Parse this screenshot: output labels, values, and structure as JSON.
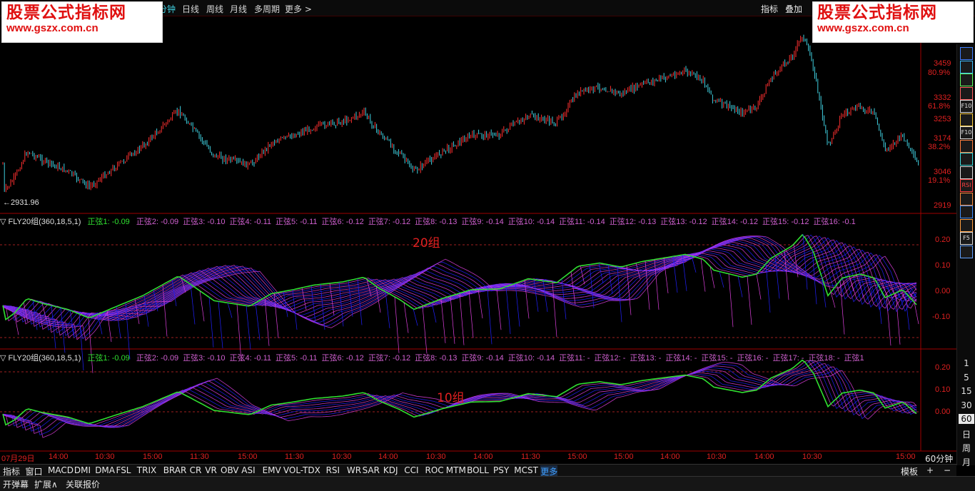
{
  "topbar": {
    "items": [
      "分钟",
      "日线",
      "周线",
      "月线",
      "多周期",
      "更多 >"
    ],
    "right_items": [
      "指标",
      "叠加"
    ]
  },
  "watermark": {
    "line1": "股票公式指标网",
    "line2": "www.gszx.com.cn"
  },
  "price_chart": {
    "low_label": "←2931.96",
    "price_ticks": [
      "3459",
      "3332",
      "3253",
      "3174",
      "3046",
      "2919"
    ],
    "pct_ticks": [
      "80.9%",
      "61.8%",
      "38.2%",
      "19.1%"
    ]
  },
  "indicator1": {
    "name": "▽ FLY20组(360,18,5,1)",
    "first": "正弦1: -0.09",
    "rest": [
      "正弦2: -0.09",
      "正弦3: -0.10",
      "正弦4: -0.11",
      "正弦5: -0.11",
      "正弦6: -0.12",
      "正弦7: -0.12",
      "正弦8: -0.13",
      "正弦9: -0.14",
      "正弦10: -0.14",
      "正弦11: -0.14",
      "正弦12: -0.13",
      "正弦13: -0.12",
      "正弦14: -0.12",
      "正弦15: -0.12",
      "正弦16: -0.1"
    ],
    "annotation": "20组",
    "ticks": [
      "0.20",
      "0.10",
      "0.00",
      "-0.10"
    ]
  },
  "indicator2": {
    "name": "▽ FLY20组(360,18,5,1)",
    "first": "正弦1: -0.09",
    "rest": [
      "正弦2: -0.09",
      "正弦3: -0.10",
      "正弦4: -0.11",
      "正弦5: -0.11",
      "正弦6: -0.12",
      "正弦7: -0.12",
      "正弦8: -0.13",
      "正弦9: -0.14",
      "正弦10: -0.14",
      "正弦11: -",
      "正弦12: -",
      "正弦13: -",
      "正弦14: -",
      "正弦15: -",
      "正弦16: -",
      "正弦17: -",
      "正弦18: -",
      "正弦1"
    ],
    "annotation": "10组",
    "ticks": [
      "0.20",
      "0.10",
      "0.00"
    ]
  },
  "time_axis": {
    "labels": [
      "07月29日",
      "14:00",
      "10:30",
      "15:00",
      "11:30",
      "15:00",
      "11:30",
      "10:30",
      "14:00",
      "10:30",
      "14:00",
      "11:30",
      "15:00",
      "15:00",
      "14:00",
      "10:30",
      "14:00",
      "10:30",
      "15:00"
    ],
    "period": "60分钟"
  },
  "sidebar": {
    "icons": [
      "list-icon",
      "grid-icon",
      "chart-icon",
      "bar-icon",
      "F10",
      "doc-icon",
      "F10",
      "calc-icon",
      "refresh-icon",
      "lock-icon",
      "RSI",
      "s-icon",
      "move-icon",
      "pencil-icon",
      "F5",
      "book-icon"
    ],
    "periods": [
      "1",
      "5",
      "15",
      "30",
      "60",
      "日",
      "周",
      "月"
    ]
  },
  "indicator_tabs": [
    "指标",
    "窗口",
    "MACD",
    "DMI",
    "DMA",
    "FSL",
    "TRIX",
    "BRAR",
    "CR",
    "VR",
    "OBV",
    "ASI",
    "EMV",
    "VOL-TDX",
    "RSI",
    "WR",
    "SAR",
    "KDJ",
    "CCI",
    "ROC",
    "MTM",
    "BOLL",
    "PSY",
    "MCST",
    "更多"
  ],
  "indicator_bar_right": [
    "模板",
    "+",
    "−"
  ],
  "bottom_bar": [
    "开弹幕",
    "扩展∧",
    "关联报价"
  ],
  "colors": {
    "up": "#ff3030",
    "down": "#40d0e0",
    "magenta": "#e040e0",
    "blue": "#2020ff",
    "green": "#30e030",
    "axis": "#e02020"
  }
}
